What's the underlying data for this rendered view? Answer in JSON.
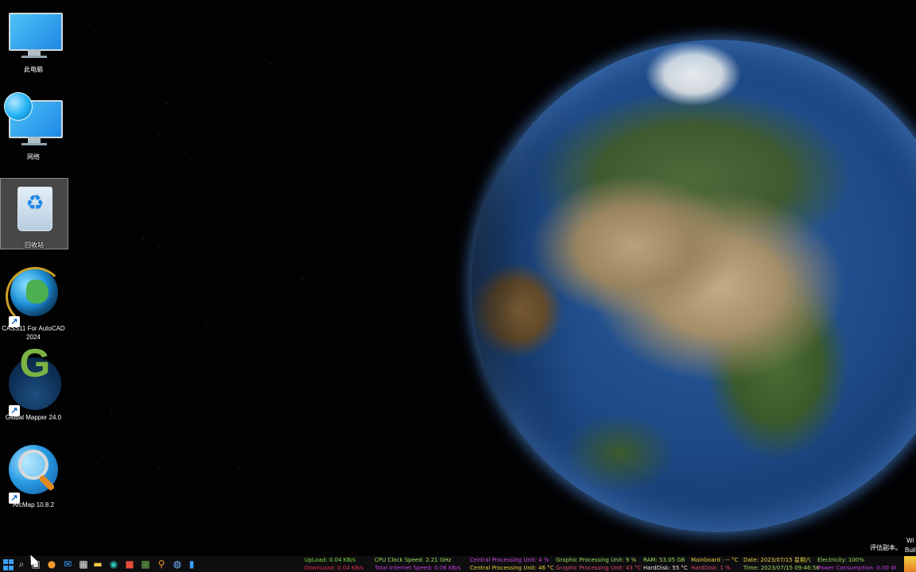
{
  "desktop_icons": [
    {
      "label": "此电脑",
      "icon": "this-pc-icon"
    },
    {
      "label": "网络",
      "icon": "network-icon"
    },
    {
      "label": "回收站",
      "icon": "recycle-bin-icon"
    },
    {
      "label": "CASS11 For AutoCAD 2024",
      "icon": "cass-globe-icon"
    },
    {
      "label": "Global Mapper 24.0",
      "icon": "global-mapper-icon"
    },
    {
      "label": "ArcMap 10.8.2",
      "icon": "arcmap-icon"
    }
  ],
  "taskbar": {
    "apps": [
      "start-icon",
      "search-icon",
      "task-view-icon",
      "browser-icon",
      "mail-icon",
      "calendar-icon",
      "file-explorer-icon",
      "edge-icon",
      "store-icon",
      "image-app-icon",
      "search-tool-icon",
      "app-icon",
      "app-icon"
    ]
  },
  "stats": {
    "upload": "UpLoad: 0.04 KB/s",
    "download": "DownLoad: 0.04 KB/s",
    "cpu_clock": "CPU Clock Speed: 2.21 GHz",
    "internet_speed": "Total Internet Speed: 0.08 KB/s",
    "cpu_usage": "Central Processing Unit: 4 %",
    "cpu_temp": "Central Processing Unit: 46 °C",
    "gpu_usage": "Graphic Processing Unit: 9 %",
    "gpu_temp": "Graphic Processing Unit: 43 °C",
    "ram": "RAM: 53.05 GB",
    "harddisk_temp": "HardDisk: 55 °C",
    "mainboard": "Mainboard : -- °C",
    "harddisk_usage": "HardDisk: 1 %",
    "date": "Date: 2023/07/15  星期六",
    "time": "Time: 2023/07/15 09:46:56",
    "electricity": "Electricity: 100%",
    "power": "Power Consumption: 0.00 W"
  },
  "watermark": {
    "line1": "评估副本。",
    "line2a": "Wi",
    "line2b": "Buil"
  },
  "colors": {
    "upload": "#7ddc3a",
    "download": "#e0304a",
    "cpu_clock": "#9edc5a",
    "internet_speed": "#c040e0",
    "cpu_usage": "#d040e0",
    "cpu_temp": "#e8d040",
    "gpu_usage": "#9edc5a",
    "gpu_temp": "#e04a6a",
    "ram": "#9edc5a",
    "harddisk_temp": "#e8e8e8",
    "mainboard": "#e8d040",
    "harddisk_usage": "#e04a6a",
    "date": "#e8d040",
    "time": "#9edc5a",
    "electricity": "#9edc5a",
    "power": "#c040e0"
  }
}
